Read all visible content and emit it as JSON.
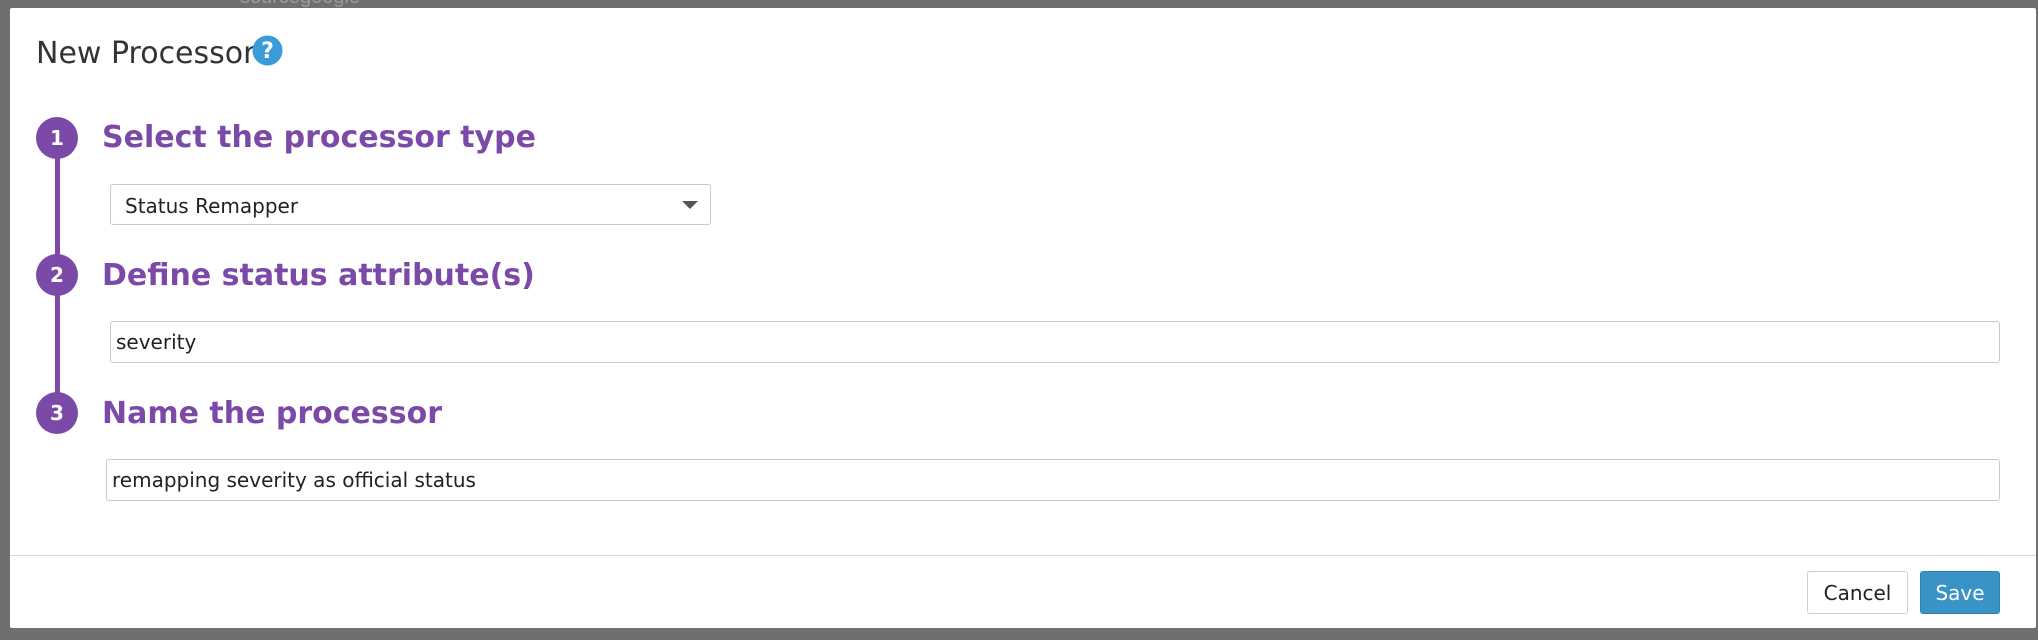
{
  "background": {
    "partial_text": "sourcegoogle"
  },
  "modal": {
    "title": "New Processor",
    "help_icon": "question-circle-icon"
  },
  "steps": [
    {
      "number": "1",
      "title": "Select the processor type"
    },
    {
      "number": "2",
      "title": "Define status attribute(s)"
    },
    {
      "number": "3",
      "title": "Name the processor"
    }
  ],
  "processor_type": {
    "selected": "Status Remapper"
  },
  "status_attribute": {
    "value": "severity"
  },
  "processor_name": {
    "value": "remapping severity as official status"
  },
  "footer": {
    "cancel_label": "Cancel",
    "save_label": "Save"
  },
  "colors": {
    "accent_purple": "#7b4aa8",
    "primary_blue": "#3a93c6",
    "help_blue": "#3a9bd9"
  }
}
